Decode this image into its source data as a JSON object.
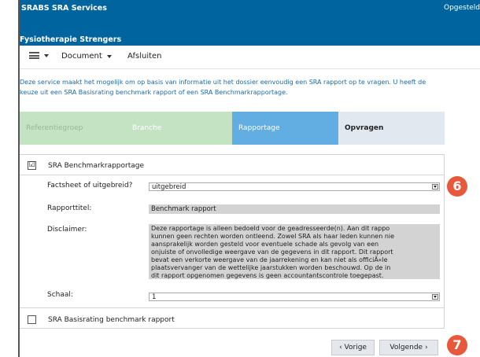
{
  "header": {
    "company": "SRABS SRA Services",
    "status": "Opgesteld",
    "subtitle": "Fysiotherapie Strengers"
  },
  "toolbar": {
    "menu_icon": "hamburger-icon",
    "document_label": "Document",
    "close_label": "Afsluiten"
  },
  "intro": "Deze service maakt het mogelijk om op basis van informatie uit het dossier eenvoudig een SRA rapport op te vragen. U heeft de keuze uit een SRA Basisrating benchmark rapport of een SRA Benchmarkrapportage.",
  "steps": [
    {
      "label": "Referentiegroep",
      "state": "done"
    },
    {
      "label": "Branche",
      "state": "done"
    },
    {
      "label": "Rapportage",
      "state": "active"
    },
    {
      "label": "Opvragen",
      "state": "upcoming"
    }
  ],
  "colors": {
    "header": "#00659e",
    "step_done": "#c3e3c3",
    "step_active": "#62aee2",
    "step_upcoming": "#e1e8ef",
    "badge": "#e8583a",
    "intro_text": "#1a6aa8"
  },
  "options": {
    "benchmark": {
      "label": "SRA Benchmarkrapportage",
      "checked": true,
      "check_mark": "☑"
    },
    "basisrating": {
      "label": "SRA Basisrating benchmark rapport",
      "checked": false
    }
  },
  "form": {
    "factsheet_label": "Factsheet of uitgebreid?",
    "factsheet_value": "uitgebreid",
    "title_label": "Rapporttitel:",
    "title_value": "Benchmark rapport",
    "disclaimer_label": "Disclaimer:",
    "disclaimer_text": "Deze rapportage is alleen bedoeld voor de geadresseerde(n). Aan dit rappo\nkunnen geen rechten worden ontleend. Zowel SRA als haar leden kunnen nie\naansprakelijk worden gesteld voor eventuele schade als gevolg van een\nonjuiste of onvolledige weergave van de gegevens in dit rapport. Dit rapport\nbevat een verkorte weergave van de jaarrekening en kan niet als officiÃ«le\nplaatsvervanger van de wettelijke jaarstukken worden beschouwd. Op de in\ndit rapport opgenomen gegevens is geen accountantscontrole toegepast.",
    "scale_label": "Schaal:",
    "scale_value": "1"
  },
  "badges": {
    "form_badge": "6",
    "next_badge": "7"
  },
  "buttons": {
    "prev_label": "‹ Vorige",
    "next_label": "Volgende ›"
  }
}
